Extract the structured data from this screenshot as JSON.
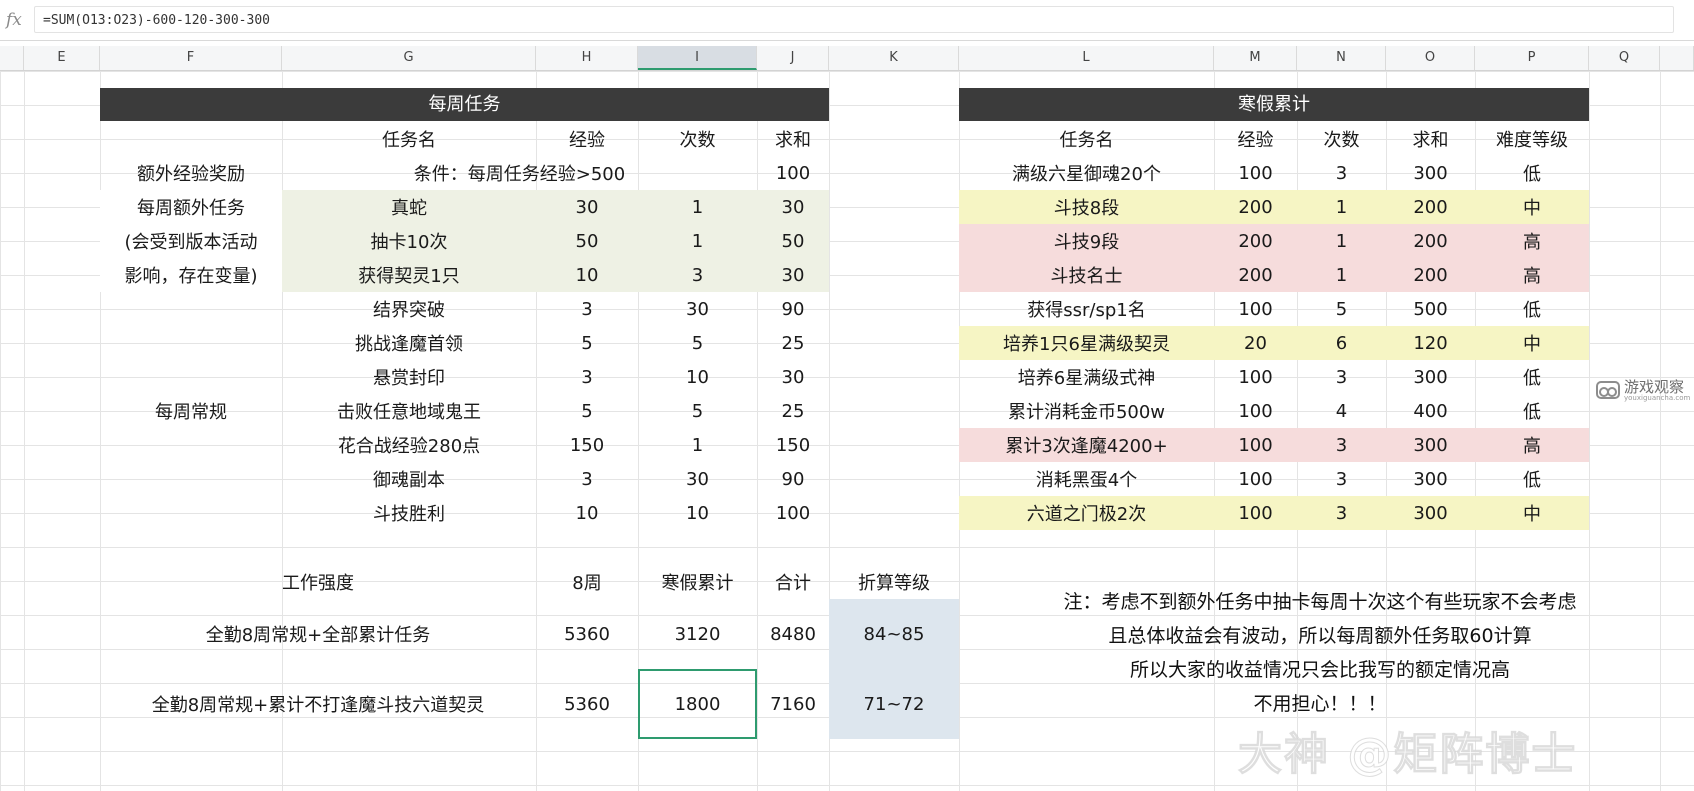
{
  "formula_bar": {
    "fx_label": "fx",
    "formula": "=SUM(O13:O23)-600-120-300-300"
  },
  "columns": [
    "E",
    "F",
    "G",
    "H",
    "I",
    "J",
    "K",
    "L",
    "M",
    "N",
    "O",
    "P",
    "Q"
  ],
  "weekly": {
    "title": "每周任务",
    "headers": [
      "任务名",
      "经验",
      "次数",
      "求和"
    ],
    "bonus": {
      "label": "额外经验奖励",
      "condition": "条件：每周任务经验>500",
      "sum": "100"
    },
    "extra_label": [
      "每周额外任务",
      "(会受到版本活动",
      "影响，存在变量)"
    ],
    "extra_rows": [
      {
        "name": "真蛇",
        "exp": "30",
        "count": "1",
        "sum": "30"
      },
      {
        "name": "抽卡10次",
        "exp": "50",
        "count": "1",
        "sum": "50"
      },
      {
        "name": "获得契灵1只",
        "exp": "10",
        "count": "3",
        "sum": "30"
      }
    ],
    "regular_label": "每周常规",
    "regular_rows": [
      {
        "name": "结界突破",
        "exp": "3",
        "count": "30",
        "sum": "90"
      },
      {
        "name": "挑战逢魔首领",
        "exp": "5",
        "count": "5",
        "sum": "25"
      },
      {
        "name": "悬赏封印",
        "exp": "3",
        "count": "10",
        "sum": "30"
      },
      {
        "name": "击败任意地域鬼王",
        "exp": "5",
        "count": "5",
        "sum": "25"
      },
      {
        "name": "花合战经验280点",
        "exp": "150",
        "count": "1",
        "sum": "150"
      },
      {
        "name": "御魂副本",
        "exp": "3",
        "count": "30",
        "sum": "90"
      },
      {
        "name": "斗技胜利",
        "exp": "10",
        "count": "10",
        "sum": "100"
      }
    ]
  },
  "winter": {
    "title": "寒假累计",
    "headers": [
      "任务名",
      "经验",
      "次数",
      "求和",
      "难度等级"
    ],
    "rows": [
      {
        "name": "满级六星御魂20个",
        "exp": "100",
        "count": "3",
        "sum": "300",
        "level": "低",
        "color": ""
      },
      {
        "name": "斗技8段",
        "exp": "200",
        "count": "1",
        "sum": "200",
        "level": "中",
        "color": "yellow"
      },
      {
        "name": "斗技9段",
        "exp": "200",
        "count": "1",
        "sum": "200",
        "level": "高",
        "color": "pink"
      },
      {
        "name": "斗技名士",
        "exp": "200",
        "count": "1",
        "sum": "200",
        "level": "高",
        "color": "pink"
      },
      {
        "name": "获得ssr/sp1名",
        "exp": "100",
        "count": "5",
        "sum": "500",
        "level": "低",
        "color": ""
      },
      {
        "name": "培养1只6星满级契灵",
        "exp": "20",
        "count": "6",
        "sum": "120",
        "level": "中",
        "color": "yellow"
      },
      {
        "name": "培养6星满级式神",
        "exp": "100",
        "count": "3",
        "sum": "300",
        "level": "低",
        "color": ""
      },
      {
        "name": "累计消耗金币500w",
        "exp": "100",
        "count": "4",
        "sum": "400",
        "level": "低",
        "color": ""
      },
      {
        "name": "累计3次逢魔4200+",
        "exp": "100",
        "count": "3",
        "sum": "300",
        "level": "高",
        "color": "pink"
      },
      {
        "name": "消耗黑蛋4个",
        "exp": "100",
        "count": "3",
        "sum": "300",
        "level": "低",
        "color": ""
      },
      {
        "name": "六道之门极2次",
        "exp": "100",
        "count": "3",
        "sum": "300",
        "level": "中",
        "color": "yellow"
      }
    ]
  },
  "summary": {
    "headers": [
      "工作强度",
      "8周",
      "寒假累计",
      "合计",
      "折算等级"
    ],
    "rows": [
      {
        "label": "全勤8周常规+全部累计任务",
        "w8": "5360",
        "winter": "3120",
        "total": "8480",
        "level": "84~85"
      },
      {
        "label": "全勤8周常规+累计不打逢魔斗技六道契灵",
        "w8": "5360",
        "winter": "1800",
        "total": "7160",
        "level": "71~72"
      }
    ]
  },
  "note": [
    "注：考虑不到额外任务中抽卡每周十次这个有些玩家不会考虑",
    "且总体收益会有波动，所以每周额外任务取60计算",
    "所以大家的收益情况只会比我写的额定情况高",
    "不用担心！！！"
  ],
  "side_logo": {
    "name": "游戏观察",
    "sub": "youxiguancha.com"
  },
  "watermark": "大神 @矩阵博士"
}
